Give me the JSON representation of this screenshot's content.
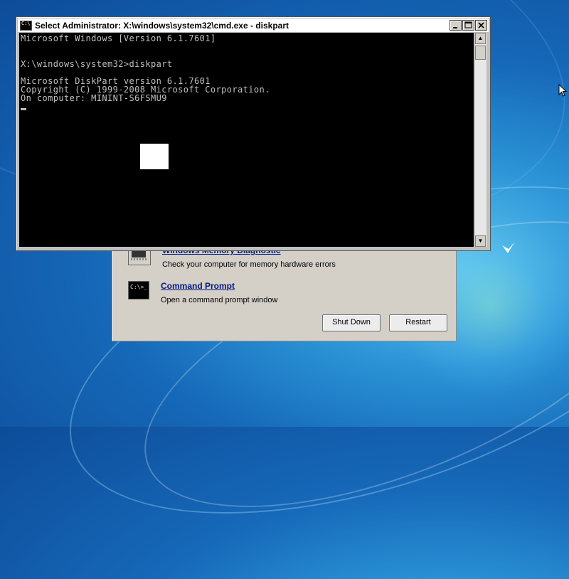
{
  "console": {
    "title": "Select Administrator: X:\\windows\\system32\\cmd.exe - diskpart",
    "lines": [
      "Microsoft Windows [Version 6.1.7601]",
      "X:\\windows\\system32>diskpart",
      "Microsoft DiskPart version 6.1.7601",
      "Copyright (C) 1999-2008 Microsoft Corporation.",
      "On computer: MININT-S6FSMU9"
    ]
  },
  "recovery": {
    "memory_title": "Windows Memory Diagnostic",
    "memory_desc": "Check your computer for memory hardware errors",
    "cmd_title": "Command Prompt",
    "cmd_desc": "Open a command prompt window",
    "cmd_icon_text": "C:\\>_",
    "shutdown_label": "Shut Down",
    "restart_label": "Restart"
  },
  "icons": {
    "console": "cmd-icon",
    "minimize": "minimize-icon",
    "maximize": "maximize-icon",
    "close": "close-icon",
    "memory": "memory-chip-icon",
    "mouse": "mouse-pointer-icon"
  }
}
